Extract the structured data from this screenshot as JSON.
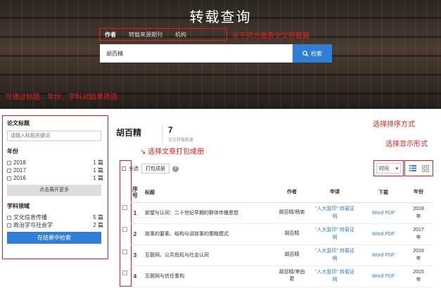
{
  "hero": {
    "title": "转载查询",
    "tabs": [
      "作者",
      "转载来源期刊",
      "机构"
    ],
    "tab_hint": "从不同方面查全文转载篇",
    "search_value": "胡百精",
    "search_button": "检索"
  },
  "hints": {
    "filter": "可通过标题、年份、学科对结果筛选",
    "pack": "选择文章打包成册",
    "sort": "选择排序方式",
    "view": "选择显示形式"
  },
  "sidebar": {
    "title_label": "论文标题",
    "title_placeholder": "请输入标题关键词",
    "year_label": "年份",
    "years": [
      {
        "label": "2018",
        "count": "1 篇"
      },
      {
        "label": "2017",
        "count": "1 篇"
      },
      {
        "label": "2016",
        "count": "1 篇"
      }
    ],
    "more_button": "点击展开更多",
    "subject_label": "学科领域",
    "subjects": [
      {
        "label": "文化信息传播",
        "count": "5 篇"
      },
      {
        "label": "政治学与社会学",
        "count": "2 篇"
      }
    ],
    "search_in_results": "在结果中检索"
  },
  "results": {
    "query": "胡百精",
    "count": "7",
    "count_label": "论文转载数量",
    "select_all": "全选",
    "pack_button": "打包成册",
    "sort_value": "时间",
    "columns": [
      "序号",
      "标题",
      "作者",
      "申请",
      "下载",
      "年份"
    ],
    "rows": [
      {
        "no": "1",
        "title": "欲望与认同：二十世纪早期的群体传播思想",
        "author": "胡百精/杨奕",
        "apply_1": "\"人大复印\" 转载证",
        "apply_2": "明",
        "dl": "Word  PDF",
        "year": "2018",
        "year_unit": "年"
      },
      {
        "no": "2",
        "title": "故事的要素、结构与讲故事的策略模式",
        "author": "胡百精",
        "apply_1": "\"人大复印\" 转载证",
        "apply_2": "明",
        "dl": "Word  PDF",
        "year": "2017",
        "year_unit": "年"
      },
      {
        "no": "3",
        "title": "互联网、公共危机与社会认同",
        "author": "胡百精",
        "apply_1": "\"人大复印\" 转载证",
        "apply_2": "明",
        "dl": "Word  PDF",
        "year": "2016",
        "year_unit": "年"
      },
      {
        "no": "4",
        "title": "互联网与信任重构",
        "author": "胡百精/李由君",
        "apply_1": "\"人大复印\" 转载证",
        "apply_2": "明",
        "dl": "Word  PDF",
        "year": "2015",
        "year_unit": "年"
      }
    ]
  },
  "colors": {
    "accent": "#2f7fd6",
    "annotation": "#e02020"
  }
}
